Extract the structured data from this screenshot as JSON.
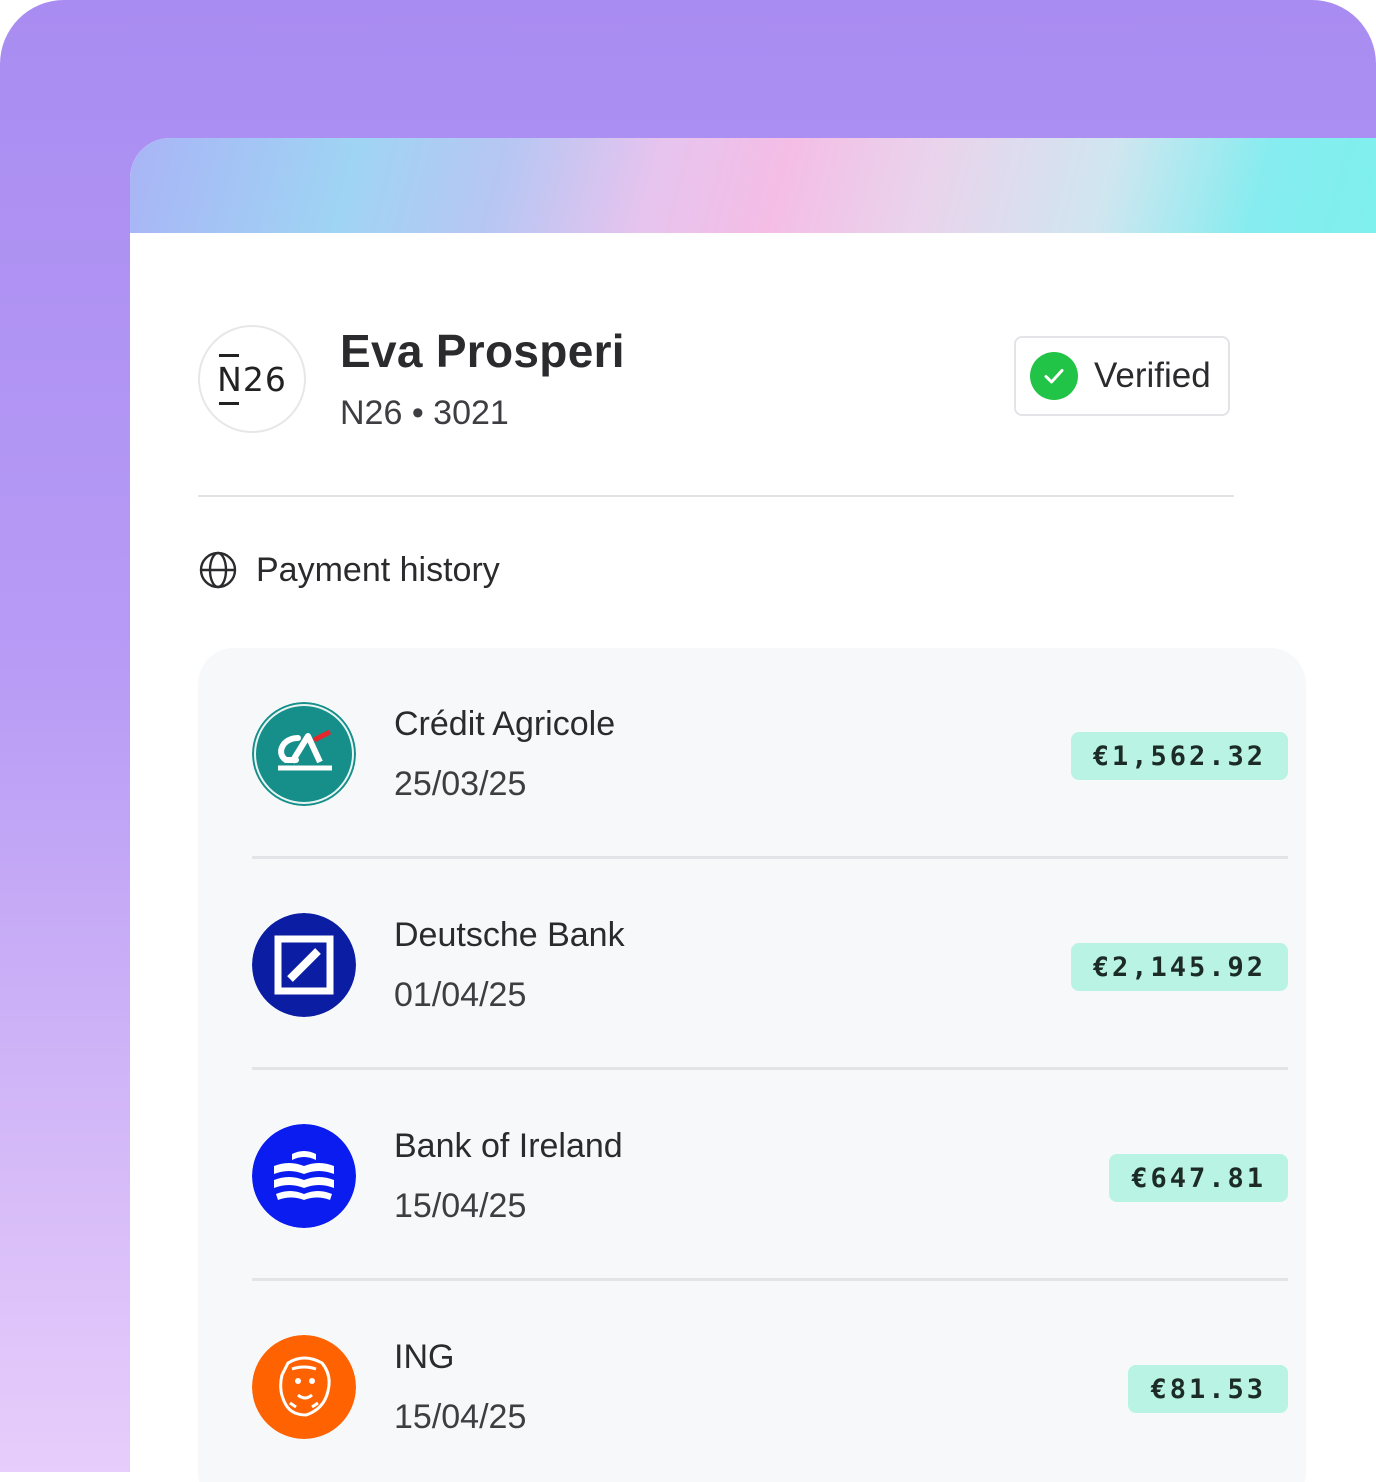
{
  "account": {
    "logo_text": "N26",
    "name": "Eva Prosperi",
    "subtitle": "N26 • 3021",
    "status": "Verified"
  },
  "payment_history": {
    "title": "Payment history",
    "items": [
      {
        "bank": "Crédit Agricole",
        "date": "25/03/25",
        "amount": "€1,562.32",
        "logo": "credit-agricole-logo",
        "color": "#168f8a"
      },
      {
        "bank": "Deutsche Bank",
        "date": "01/04/25",
        "amount": "€2,145.92",
        "logo": "deutsche-bank-logo",
        "color": "#0b1ea3"
      },
      {
        "bank": "Bank of Ireland",
        "date": "15/04/25",
        "amount": "€647.81",
        "logo": "bank-of-ireland-logo",
        "color": "#0a1cf0"
      },
      {
        "bank": "ING",
        "date": "15/04/25",
        "amount": "€81.53",
        "logo": "ing-logo",
        "color": "#ff6200"
      }
    ]
  },
  "colors": {
    "backdrop": "#a98cf1",
    "verified": "#22c447",
    "amount_chip": "#b8f3e4"
  }
}
